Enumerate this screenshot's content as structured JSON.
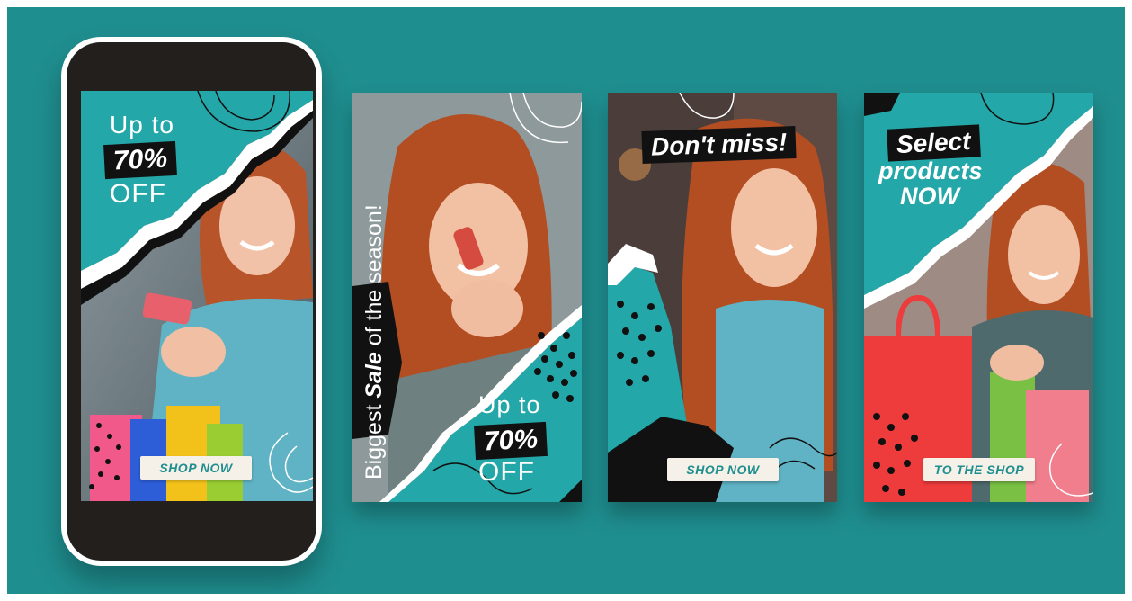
{
  "colors": {
    "teal": "#23a7a8",
    "background": "#1f8e8f",
    "button_bg": "#f6f1e8",
    "button_text": "#1f8e8f",
    "black": "#111111"
  },
  "phone_story": {
    "line1": "Up to",
    "percent": "70%",
    "line3": "OFF",
    "button": "SHOP NOW"
  },
  "story1": {
    "vertical_pre": "Biggest ",
    "vertical_bold": "Sale",
    "vertical_post": " of the season!",
    "line1": "Up to",
    "percent": "70%",
    "line3": "OFF"
  },
  "story2": {
    "headline": "Don't miss!",
    "button": "SHOP NOW"
  },
  "story3": {
    "headline_1": "Select",
    "headline_2": "products",
    "headline_3": "NOW",
    "button": "TO THE SHOP"
  }
}
